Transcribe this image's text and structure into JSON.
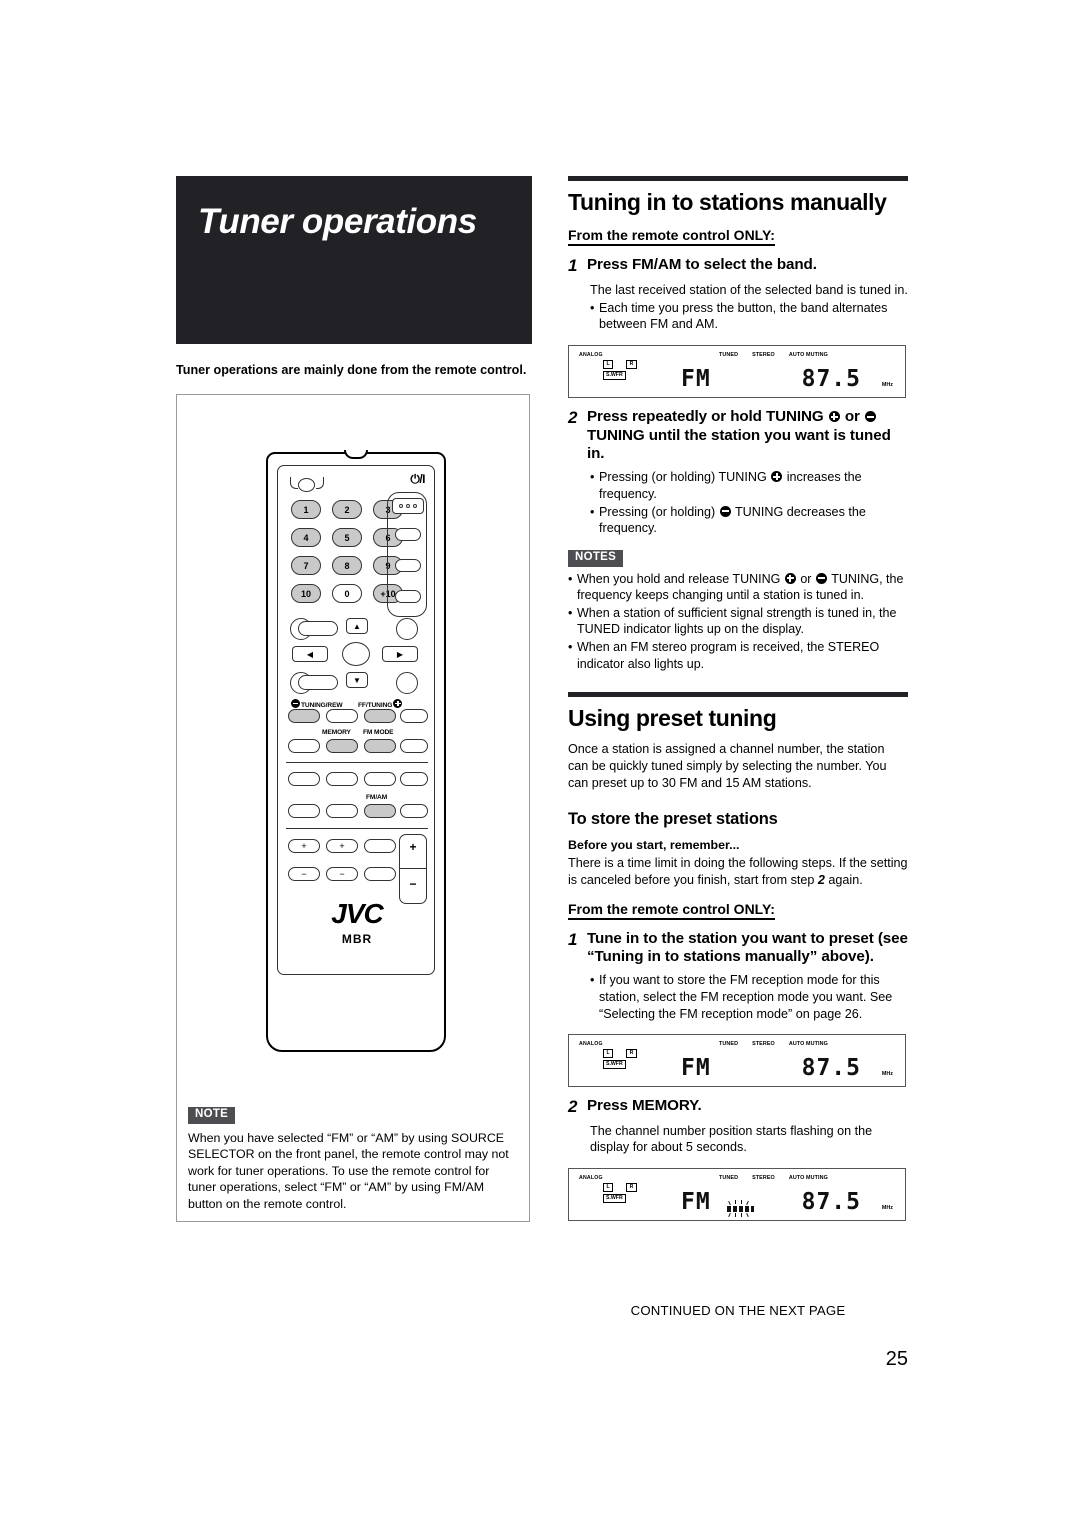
{
  "page": {
    "number": "25",
    "continued": "CONTINUED ON THE NEXT PAGE"
  },
  "left": {
    "title": "Tuner operations",
    "intro": "Tuner operations are mainly done from the remote control.",
    "note": {
      "tag": "NOTE",
      "text": "When you have selected “FM” or “AM” by using SOURCE SELECTOR on the front panel, the remote control may not work for tuner operations. To use the remote control for tuner operations, select “FM” or “AM” by using FM/AM button on the remote control."
    },
    "remote": {
      "power_label": "⏻/I",
      "keys": [
        "1",
        "2",
        "3",
        "4",
        "5",
        "6",
        "7",
        "8",
        "9",
        "10",
        "0",
        "+10"
      ],
      "labels": {
        "tuning_rew": "TUNING/REW",
        "ff_tuning": "FF/TUNING",
        "memory": "MEMORY",
        "fm_mode": "FM MODE",
        "fm_am": "FM/AM"
      },
      "brand": "JVC",
      "brand_sub": "MBR",
      "vol_plus": "+",
      "vol_minus": "−",
      "plus": "+",
      "minus": "−",
      "arrow_up": "▲",
      "arrow_down": "▼",
      "arrow_left": "◀",
      "arrow_right": "▶"
    }
  },
  "right": {
    "section1": {
      "heading": "Tuning in to stations manually",
      "subhead": "From the remote control ONLY:",
      "step1": {
        "num": "1",
        "title": "Press FM/AM to select the band.",
        "body": "The last received station of the selected band is tuned in.",
        "bullets": [
          "Each time you press the button, the band alternates between FM and AM."
        ]
      },
      "step2": {
        "num": "2",
        "title_a": "Press repeatedly or hold TUNING",
        "title_b": "or",
        "title_c": "TUNING until the station you want is tuned in.",
        "bullets": [
          {
            "a": "Pressing (or holding) TUNING",
            "b": "increases the frequency.",
            "icon": "plus"
          },
          {
            "a": "Pressing (or holding)",
            "b": "TUNING decreases the frequency.",
            "icon": "minus"
          }
        ]
      },
      "notes": {
        "tag": "NOTES",
        "items": [
          {
            "a": "When you hold and release TUNING",
            "mid": "or",
            "b": "TUNING, the frequency keeps changing until a station is tuned in."
          },
          {
            "text": "When a station of sufficient signal strength is tuned in, the TUNED indicator lights up on the display."
          },
          {
            "text": "When an FM stereo program is received, the STEREO indicator also lights up."
          }
        ]
      }
    },
    "section2": {
      "heading": "Using preset tuning",
      "intro": "Once a station is assigned a channel number, the station can be quickly tuned simply by selecting the number. You can preset up to 30 FM and 15 AM stations.",
      "sub_heading": "To store the preset stations",
      "before_label": "Before you start, remember...",
      "before_text_a": "There is a time limit in doing the following steps. If the setting is canceled before you finish, start from step",
      "before_step": "2",
      "before_text_b": "again.",
      "subhead": "From the remote control ONLY:",
      "step1": {
        "num": "1",
        "title": "Tune in to the station you want to preset (see “Tuning in to stations manually” above).",
        "bullets": [
          "If you want to store the FM reception mode for this station, select the FM reception mode you want. See “Selecting the FM reception mode” on page 26."
        ]
      },
      "step2": {
        "num": "2",
        "title": "Press MEMORY.",
        "body": "The channel number position starts flashing on the display for about 5 seconds."
      }
    }
  },
  "lcd": {
    "analog": "ANALOG",
    "left_ch": "L",
    "right_ch": "R",
    "swfr": "S.WFR",
    "indicators": [
      "TUNED",
      "STEREO",
      "AUTO MUTING"
    ],
    "band": "FM",
    "frequency": "87.5",
    "unit": "MHz"
  }
}
